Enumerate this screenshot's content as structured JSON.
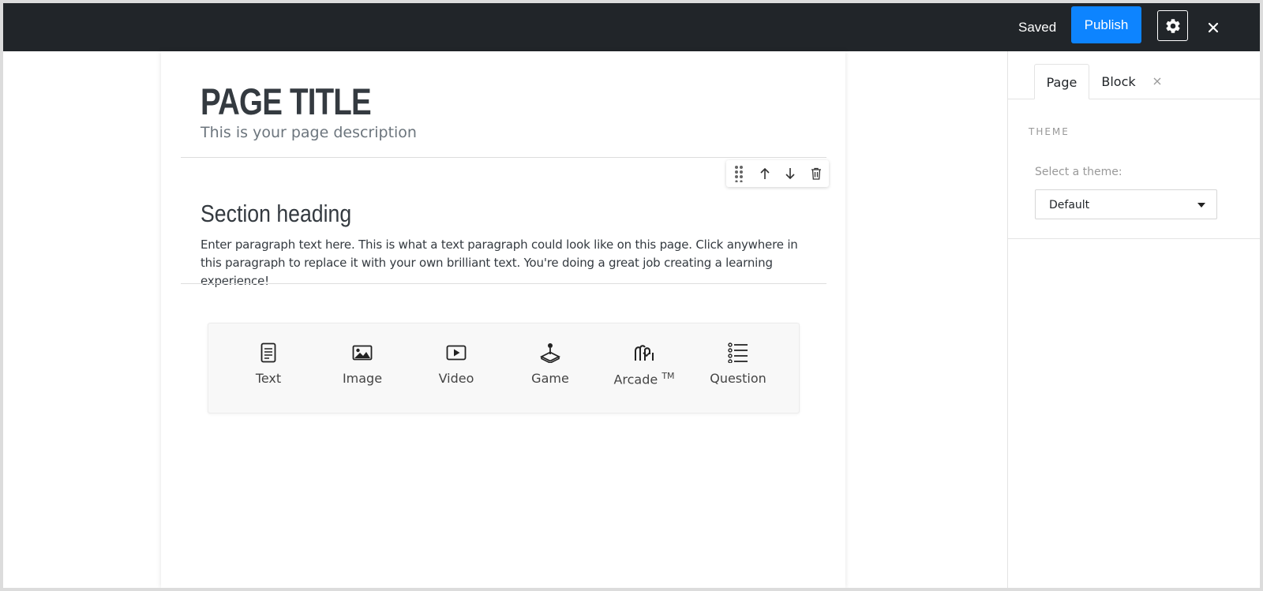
{
  "topbar": {
    "status": "Saved",
    "publish_label": "Publish",
    "settings_icon": "gear-icon",
    "close_icon": "close-icon"
  },
  "page": {
    "title": "PAGE TITLE",
    "description": "This is your page description"
  },
  "block_toolbar": {
    "icons": [
      "drag-handle-icon",
      "arrow-up-icon",
      "arrow-down-icon",
      "trash-icon"
    ]
  },
  "section": {
    "heading": "Section heading",
    "paragraph": "Enter paragraph text here. This is what a text paragraph could look like on this page. Click anywhere in this paragraph to replace it with your own brilliant text. You're doing a great job creating a learning experience!"
  },
  "block_picker": {
    "items": [
      {
        "label": "Text",
        "icon": "text-document-icon"
      },
      {
        "label": "Image",
        "icon": "image-icon"
      },
      {
        "label": "Video",
        "icon": "video-play-icon"
      },
      {
        "label": "Game",
        "icon": "joystick-icon"
      },
      {
        "label": "Arcade",
        "sup": "TM",
        "icon": "arcade-icon"
      },
      {
        "label": "Question",
        "icon": "list-icon"
      }
    ]
  },
  "sidebar": {
    "tabs": [
      {
        "label": "Page",
        "active": true
      },
      {
        "label": "Block",
        "active": false
      }
    ],
    "close_icon": "close-icon",
    "section_label": "THEME",
    "select_label": "Select a theme:",
    "select_value": "Default"
  },
  "colors": {
    "topbar_bg": "#212529",
    "publish_bg": "#0d84ff",
    "text_dark": "#343a40",
    "text_muted": "#6c757d"
  }
}
